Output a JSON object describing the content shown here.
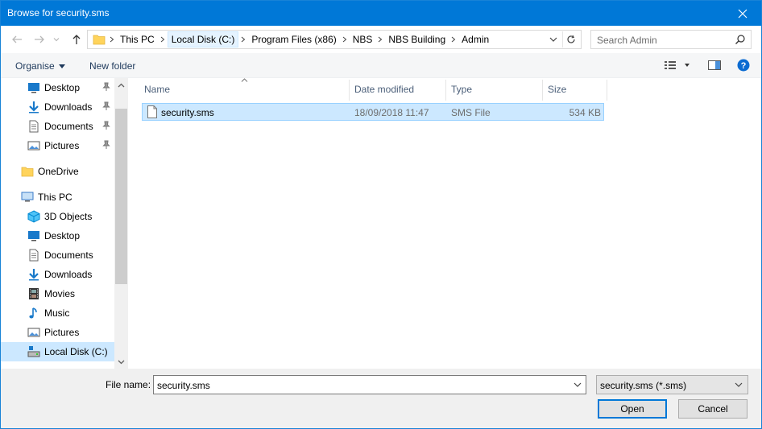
{
  "window": {
    "title": "Browse for security.sms"
  },
  "address": {
    "crumbs": [
      "This PC",
      "Local Disk (C:)",
      "Program Files (x86)",
      "NBS",
      "NBS Building",
      "Admin"
    ]
  },
  "search": {
    "placeholder": "Search Admin"
  },
  "toolbar": {
    "organise": "Organise",
    "new_folder": "New folder"
  },
  "sidebar": {
    "quick_access": [
      {
        "label": "Desktop",
        "icon": "desktop-icon"
      },
      {
        "label": "Downloads",
        "icon": "download-icon"
      },
      {
        "label": "Documents",
        "icon": "document-icon"
      },
      {
        "label": "Pictures",
        "icon": "picture-icon"
      }
    ],
    "onedrive": "OneDrive",
    "this_pc": "This PC",
    "this_pc_items": [
      {
        "label": "3D Objects",
        "icon": "cube-icon"
      },
      {
        "label": "Desktop",
        "icon": "desktop-icon"
      },
      {
        "label": "Documents",
        "icon": "document-icon"
      },
      {
        "label": "Downloads",
        "icon": "download-icon"
      },
      {
        "label": "Movies",
        "icon": "film-icon"
      },
      {
        "label": "Music",
        "icon": "music-note-icon"
      },
      {
        "label": "Pictures",
        "icon": "picture-icon"
      },
      {
        "label": "Local Disk (C:)",
        "icon": "drive-icon"
      }
    ]
  },
  "columns": {
    "name": "Name",
    "date": "Date modified",
    "type": "Type",
    "size": "Size"
  },
  "files": [
    {
      "name": "security.sms",
      "date": "18/09/2018 11:47",
      "type": "SMS File",
      "size": "534 KB"
    }
  ],
  "footer": {
    "file_name_label": "File name:",
    "file_name_value": "security.sms",
    "filter": "security.sms (*.sms)",
    "open": "Open",
    "cancel": "Cancel"
  },
  "colors": {
    "titlebar": "#0078d7",
    "selection": "#cce8ff",
    "selection_border": "#99d1ff",
    "help": "#0b6bd1"
  }
}
